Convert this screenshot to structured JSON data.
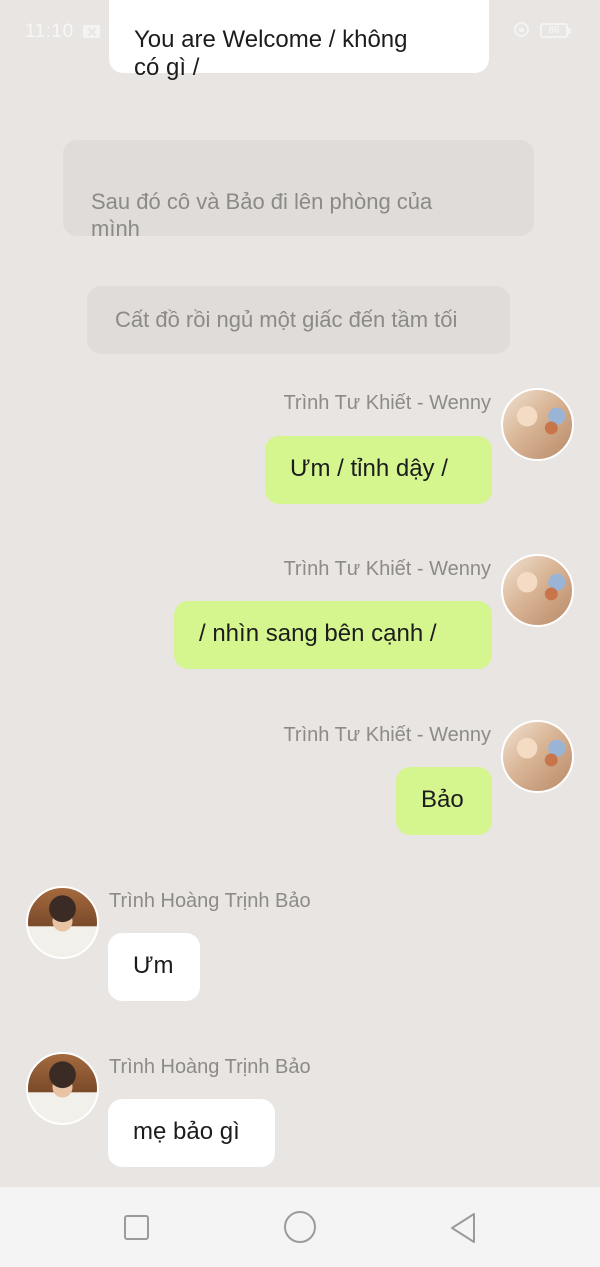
{
  "status_bar": {
    "time": "11:10",
    "battery": "86",
    "icons": [
      "notification-x-icon",
      "lock-rotation-icon",
      "battery-icon"
    ]
  },
  "messages": [
    {
      "kind": "bubble",
      "side": "left",
      "text": "You are Welcome / không\ncó gì /"
    },
    {
      "kind": "narration",
      "text": "Sau đó cô và Bảo đi lên phòng của\nmình"
    },
    {
      "kind": "narration",
      "text": "Cất đồ rồi ngủ một giấc đến tầm tối"
    },
    {
      "kind": "bubble",
      "side": "right",
      "sender": "Trình Tư Khiết - Wenny",
      "text": "Ưm / tỉnh dậy /"
    },
    {
      "kind": "bubble",
      "side": "right",
      "sender": "Trình Tư Khiết - Wenny",
      "text": "/ nhìn sang bên cạnh /"
    },
    {
      "kind": "bubble",
      "side": "right",
      "sender": "Trình Tư Khiết - Wenny",
      "text": "Bảo"
    },
    {
      "kind": "bubble",
      "side": "left",
      "sender": "Trình  Hoàng Trịnh Bảo",
      "text": "Ưm"
    },
    {
      "kind": "bubble",
      "side": "left",
      "sender": "Trình  Hoàng Trịnh Bảo",
      "text": "mẹ bảo gì"
    }
  ],
  "nav_bar": {
    "icons": [
      "recent-apps-icon",
      "home-icon",
      "back-icon"
    ]
  },
  "colors": {
    "background": "#e8e5e2",
    "own_bubble": "#d5f58f",
    "other_bubble": "#ffffff",
    "narration_bubble": "#dfdcd9",
    "sender_name": "#8d8b88"
  }
}
